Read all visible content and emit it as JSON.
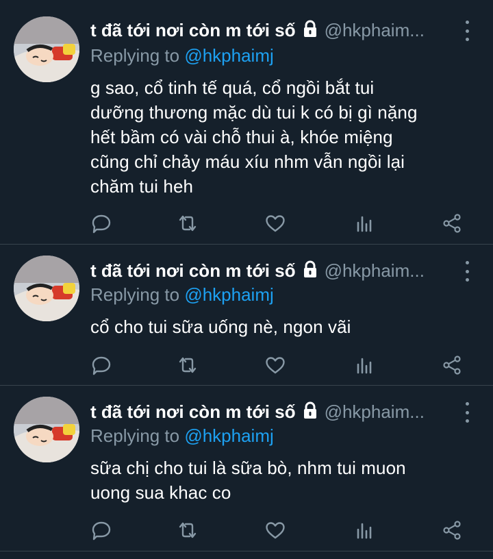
{
  "tweets": [
    {
      "name": "t đã tới nơi còn m tới số",
      "handle": "@hkphaim...",
      "replying_prefix": "Replying to ",
      "replying_to": "@hkphaimj",
      "lines": [
        "g sao, cổ tinh tế quá, cổ ngồi bắt tui",
        "dưỡng thương mặc dù tui k có bị gì nặng",
        "hết bầm có vài chỗ thui à, khóe miệng",
        "cũng chỉ chảy máu xíu nhm vẫn ngồi lại",
        "chăm tui heh"
      ]
    },
    {
      "name": "t đã tới nơi còn m tới số",
      "handle": "@hkphaim...",
      "replying_prefix": "Replying to ",
      "replying_to": "@hkphaimj",
      "lines": [
        "cổ cho tui sữa uống nè, ngon vãi"
      ]
    },
    {
      "name": "t đã tới nơi còn m tới số",
      "handle": "@hkphaim...",
      "replying_prefix": "Replying to ",
      "replying_to": "@hkphaimj",
      "lines": [
        "sữa chị cho tui là sữa bò, nhm tui muon",
        "uong sua khac co"
      ]
    }
  ],
  "icons": {
    "lock": "lock-icon",
    "more": "more-options-icon",
    "actions": [
      "reply-icon",
      "retweet-icon",
      "like-icon",
      "analytics-icon",
      "share-icon"
    ]
  },
  "colors": {
    "background": "#15202b",
    "text": "#ffffff",
    "secondary": "#8899a6",
    "accent": "#1da1f2",
    "divider": "#38444d"
  }
}
